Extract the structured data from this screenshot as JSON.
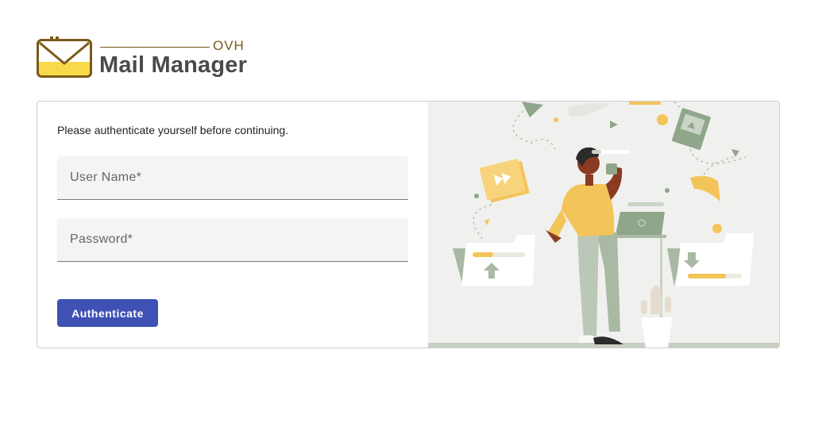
{
  "brand": {
    "sub": "OVH",
    "title": "Mail Manager",
    "logo_icon": "envelope-icon",
    "colors": {
      "logo_yellow": "#f9d94a",
      "logo_brown": "#7a5a1a",
      "title": "#4a4a4a"
    }
  },
  "login": {
    "intro": "Please authenticate yourself before continuing.",
    "username_placeholder": "User Name*",
    "password_placeholder": "Password*",
    "button_label": "Authenticate",
    "colors": {
      "button": "#3f51b5",
      "field_bg": "#f4f4f4"
    }
  },
  "illustration": {
    "subject": "person-with-phone-and-floating-files",
    "colors": {
      "bg": "#f0f1ef",
      "accent_yellow": "#f3c45a",
      "accent_sage": "#a9b9a4"
    }
  }
}
